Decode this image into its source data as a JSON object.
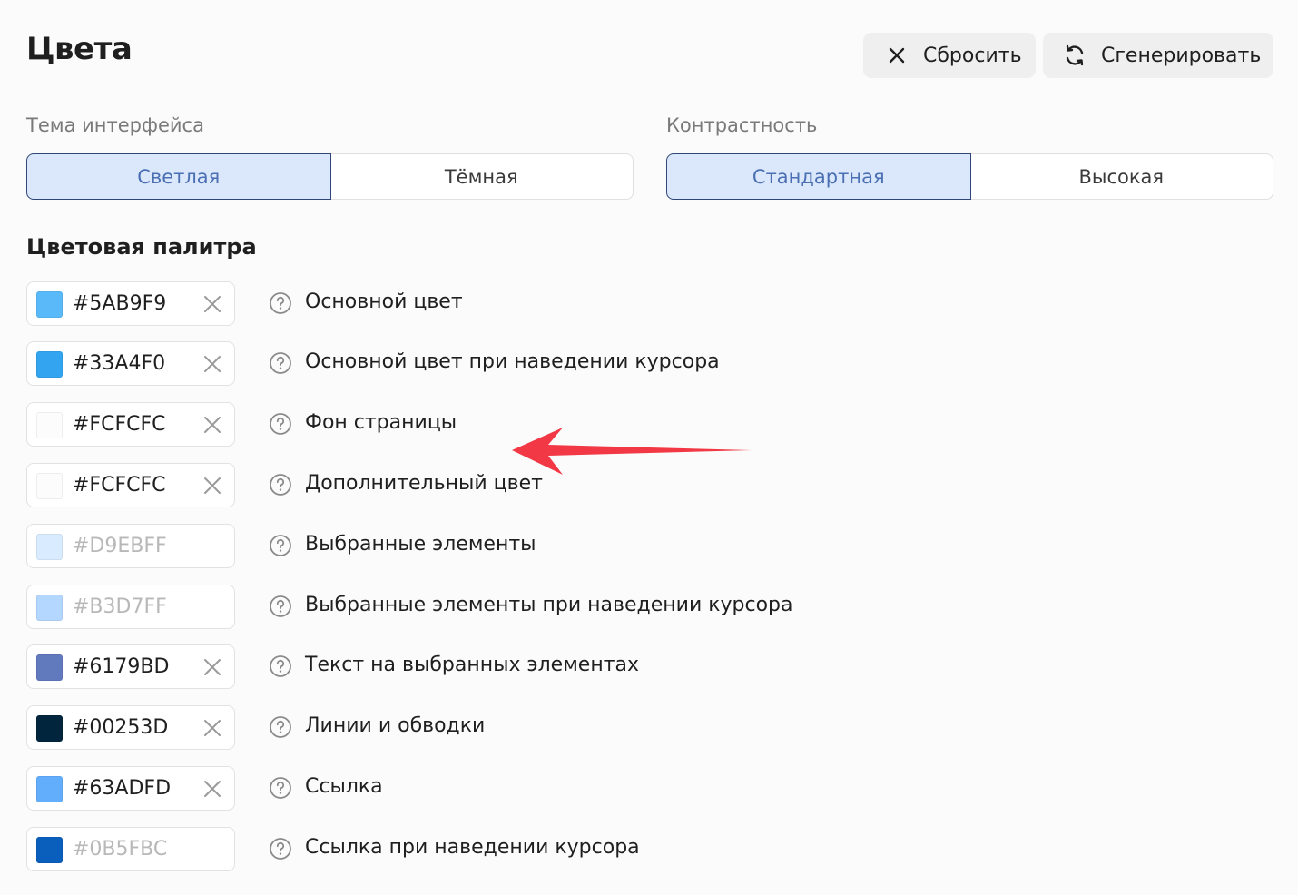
{
  "header": {
    "title": "Цвета",
    "reset_label": "Сбросить",
    "generate_label": "Сгенерировать"
  },
  "theme": {
    "label": "Тема интерфейса",
    "options": [
      "Светлая",
      "Тёмная"
    ],
    "selected": "Светлая"
  },
  "contrast": {
    "label": "Контрастность",
    "options": [
      "Стандартная",
      "Высокая"
    ],
    "selected": "Стандартная"
  },
  "palette": {
    "title": "Цветовая палитра",
    "rows": [
      {
        "hex": "#5AB9F9",
        "swatch": "#5AB9F9",
        "is_placeholder": false,
        "label": "Основной цвет"
      },
      {
        "hex": "#33A4F0",
        "swatch": "#33A4F0",
        "is_placeholder": false,
        "label": "Основной цвет при наведении курсора"
      },
      {
        "hex": "#FCFCFC",
        "swatch": "#FCFCFC",
        "is_placeholder": false,
        "label": "Фон страницы"
      },
      {
        "hex": "#FCFCFC",
        "swatch": "#FCFCFC",
        "is_placeholder": false,
        "label": "Дополнительный цвет"
      },
      {
        "hex": "#D9EBFF",
        "swatch": "#D9EBFF",
        "is_placeholder": true,
        "label": "Выбранные элементы"
      },
      {
        "hex": "#B3D7FF",
        "swatch": "#B3D7FF",
        "is_placeholder": true,
        "label": "Выбранные элементы при наведении курсора"
      },
      {
        "hex": "#6179BD",
        "swatch": "#6179BD",
        "is_placeholder": false,
        "label": "Текст на выбранных элементах"
      },
      {
        "hex": "#00253D",
        "swatch": "#00253D",
        "is_placeholder": false,
        "label": "Линии и обводки"
      },
      {
        "hex": "#63ADFD",
        "swatch": "#63ADFD",
        "is_placeholder": false,
        "label": "Ссылка"
      },
      {
        "hex": "#0B5FBC",
        "swatch": "#0B5FBC",
        "is_placeholder": true,
        "label": "Ссылка при наведении курсора"
      }
    ]
  },
  "annotation": {
    "arrow_color": "#F23845"
  }
}
